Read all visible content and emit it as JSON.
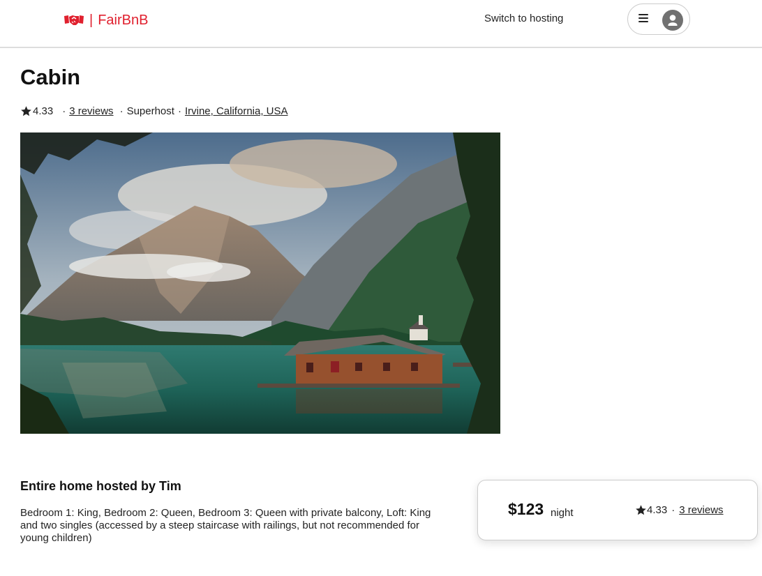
{
  "header": {
    "brand": "FairBnB",
    "separator": "|",
    "switch_label": "Switch to hosting",
    "menu_icon": "hamburger-icon",
    "avatar_icon": "user-avatar-icon"
  },
  "listing": {
    "title": "Cabin",
    "rating": "4.33",
    "reviews_label": "3 reviews",
    "superhost_label": "Superhost",
    "location": "Irvine, California, USA",
    "separator": "·",
    "host_heading": "Entire home hosted by Tim",
    "description": "Bedroom 1: King, Bedroom 2: Queen, Bedroom 3: Queen with private balcony, Loft: King and two singles (accessed by a steep staircase with railings, but not recommended for young children)"
  },
  "booking": {
    "price": "$123",
    "unit": "night",
    "rating": "4.33",
    "separator": "·",
    "reviews_label": "3 reviews"
  },
  "colors": {
    "brand": "#e0202e",
    "text": "#222222",
    "border": "#dddddd"
  }
}
